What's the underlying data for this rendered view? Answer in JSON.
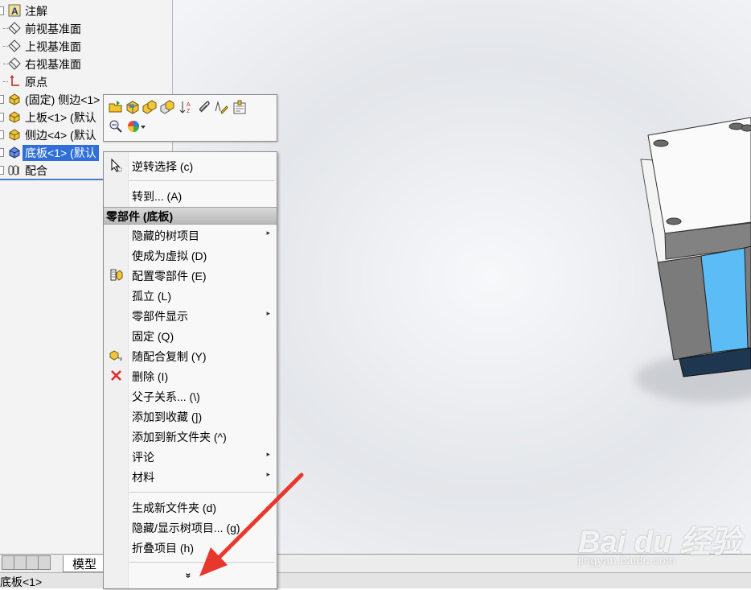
{
  "tree": {
    "items": [
      {
        "label": "注解",
        "icon": "annotation-icon"
      },
      {
        "label": "前视基准面",
        "icon": "plane-icon"
      },
      {
        "label": "上视基准面",
        "icon": "plane-icon"
      },
      {
        "label": "右视基准面",
        "icon": "plane-icon"
      },
      {
        "label": "原点",
        "icon": "origin-icon"
      },
      {
        "label": "(固定) 侧边<1>",
        "icon": "part-icon"
      },
      {
        "label": "上板<1> (默认",
        "icon": "part-icon"
      },
      {
        "label": "侧边<4> (默认",
        "icon": "part-icon"
      },
      {
        "label": "底板<1> (默认",
        "icon": "part-icon",
        "selected": true
      },
      {
        "label": "配合",
        "icon": "mates-icon"
      }
    ]
  },
  "tabs": {
    "model": "模型"
  },
  "status": {
    "text": "底板<1>"
  },
  "menu": {
    "invert_selection": "逆转选择 (c)",
    "goto": "转到... (A)",
    "header": "零部件 (底板)",
    "items": [
      {
        "label": "隐藏的树项目",
        "submenu": true
      },
      {
        "label": "使成为虚拟 (D)"
      },
      {
        "label": "配置零部件 (E)",
        "icon": "config-icon"
      },
      {
        "label": "孤立 (L)"
      },
      {
        "label": "零部件显示",
        "submenu": true
      },
      {
        "label": "固定 (Q)"
      },
      {
        "label": "随配合复制 (Y)",
        "icon": "copy-mates-icon"
      },
      {
        "label": "删除 (I)",
        "icon": "delete-icon"
      },
      {
        "label": "父子关系... (\\)"
      },
      {
        "label": "添加到收藏 (])"
      },
      {
        "label": "添加到新文件夹 (^)"
      },
      {
        "label": "评论",
        "submenu": true
      },
      {
        "label": "材料",
        "submenu": true
      }
    ],
    "items2": [
      {
        "label": "生成新文件夹 (d)"
      },
      {
        "label": "隐藏/显示树项目... (g)"
      },
      {
        "label": "折叠项目 (h)"
      }
    ],
    "more": "»"
  },
  "watermark": {
    "main": "Bai du 经验",
    "sub": "jingyan.baidu.com"
  },
  "colors": {
    "selection": "#2f6fd7",
    "arrow": "#e8382e",
    "model_blue": "#5bbcf6",
    "model_gray": "#7e7e7e",
    "model_navy": "#1f3650"
  }
}
